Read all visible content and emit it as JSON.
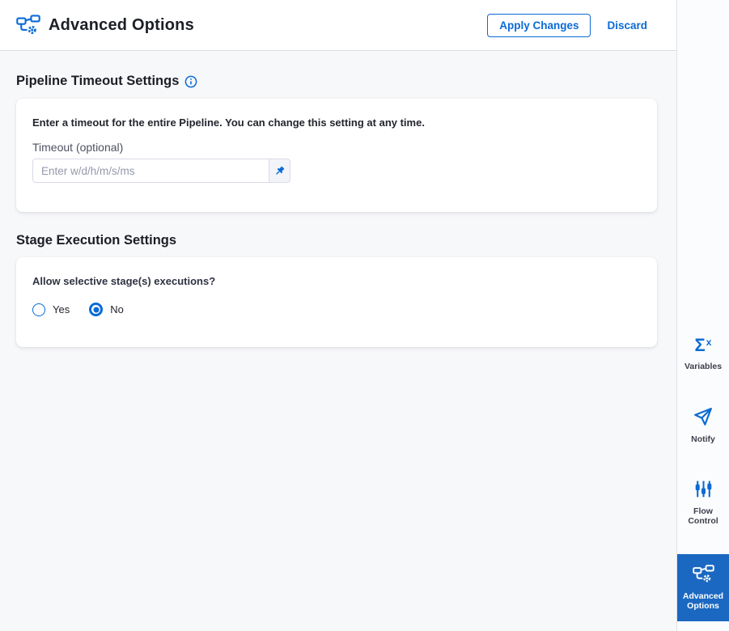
{
  "header": {
    "title": "Advanced Options",
    "apply_button": "Apply Changes",
    "discard_link": "Discard"
  },
  "sections": {
    "pipeline_timeout": {
      "heading": "Pipeline Timeout Settings",
      "info_icon": "info-icon",
      "description": "Enter a timeout for the entire Pipeline. You can change this setting at any time.",
      "timeout_label": "Timeout (optional)",
      "timeout_value": "",
      "timeout_placeholder": "Enter w/d/h/m/s/ms",
      "pin_icon": "pin-icon"
    },
    "stage_execution": {
      "heading": "Stage Execution Settings",
      "question": "Allow selective stage(s) executions?",
      "options": [
        {
          "label": "Yes",
          "selected": false
        },
        {
          "label": "No",
          "selected": true
        }
      ]
    }
  },
  "sidebar": {
    "tabs": [
      {
        "label": "Variables",
        "icon": "sigma-x-icon",
        "selected": false
      },
      {
        "label": "Notify",
        "icon": "paper-plane-icon",
        "selected": false
      },
      {
        "label": "Flow Control",
        "icon": "sliders-icon",
        "selected": false
      },
      {
        "label": "Advanced Options",
        "icon": "pipeline-gear-icon",
        "selected": true
      }
    ]
  },
  "colors": {
    "accent_blue": "#0b6bd6",
    "selected_tab_bg": "#1b68c2",
    "content_bg": "#f7f8fa",
    "card_bg": "#ffffff",
    "border": "#d9dae5"
  }
}
